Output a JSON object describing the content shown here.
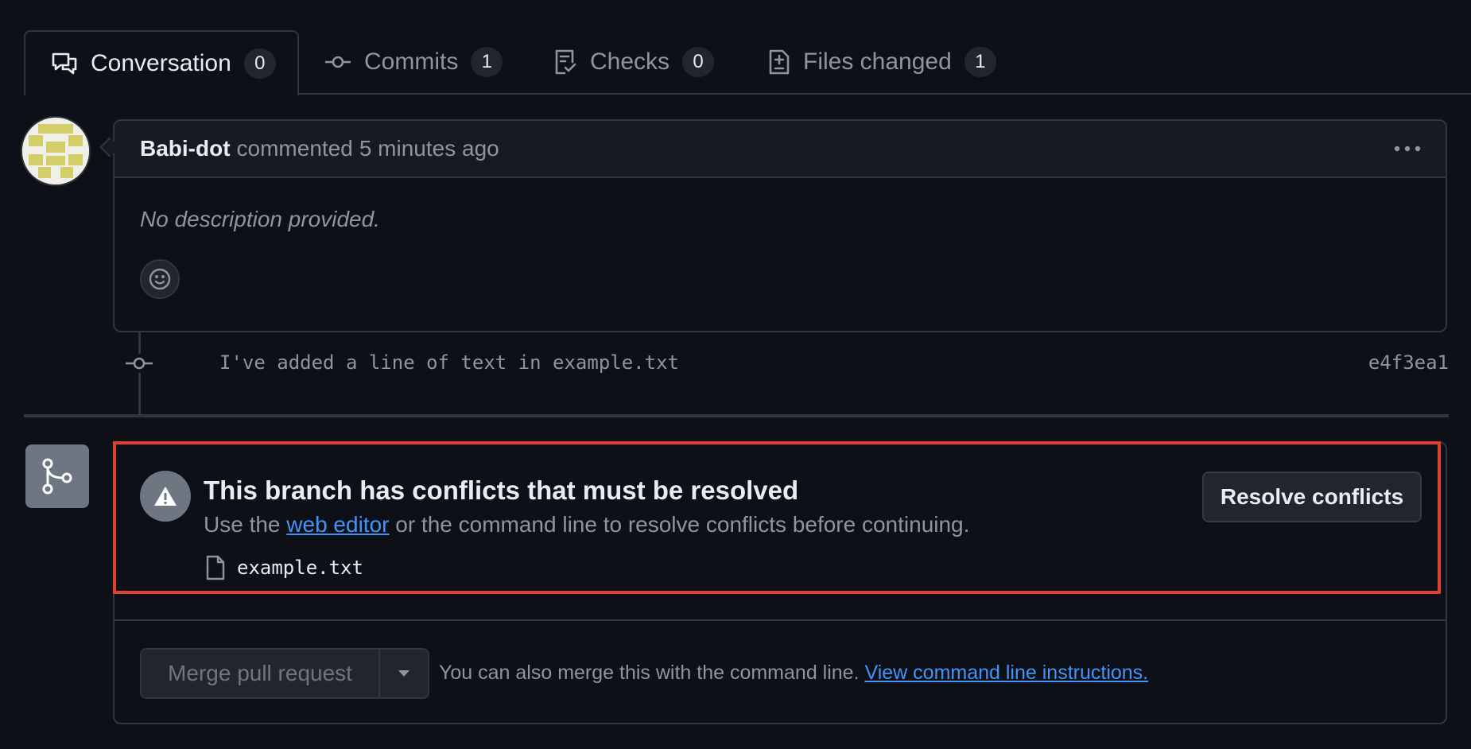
{
  "tabs": [
    {
      "label": "Conversation",
      "count": "0",
      "icon": "comment-discussion-icon",
      "active": true
    },
    {
      "label": "Commits",
      "count": "1",
      "icon": "git-commit-icon",
      "active": false
    },
    {
      "label": "Checks",
      "count": "0",
      "icon": "checklist-icon",
      "active": false
    },
    {
      "label": "Files changed",
      "count": "1",
      "icon": "file-diff-icon",
      "active": false
    }
  ],
  "comment": {
    "author": "Babi-dot",
    "action": "commented",
    "time": "5 minutes ago",
    "body": "No description provided."
  },
  "commit": {
    "message": "I've added a line of text in example.txt",
    "sha": "e4f3ea1"
  },
  "merge": {
    "conflict_title": "This branch has conflicts that must be resolved",
    "subtitle_prefix": "Use the",
    "subtitle_link": "web editor",
    "subtitle_suffix": "or the command line to resolve conflicts before continuing.",
    "conflict_file": "example.txt",
    "resolve_button": "Resolve conflicts",
    "merge_button": "Merge pull request",
    "hint_text": "You can also merge this with the command line.",
    "hint_link": "View command line instructions."
  },
  "colors": {
    "background": "#0d1117",
    "border": "#30363d",
    "link": "#4493f8",
    "highlight": "#e0402e",
    "muted": "#8d96a0"
  }
}
